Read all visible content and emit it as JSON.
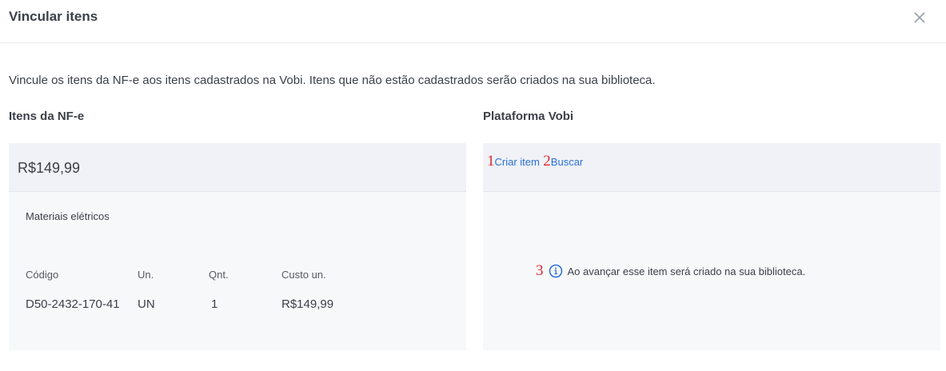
{
  "header": {
    "title": "Vincular itens"
  },
  "description": "Vincule os itens da NF-e aos itens cadastrados na Vobi. Itens que não estão cadastrados serão criados na sua biblioteca.",
  "left": {
    "heading": "Itens da NF-e",
    "price": "R$149,99",
    "category": "Materiais elétricos",
    "columns": [
      "Código",
      "Un.",
      "Qnt.",
      "Custo un."
    ],
    "row": [
      "D50-2432-170-41",
      "UN",
      "1",
      "R$149,99"
    ]
  },
  "right": {
    "heading": "Plataforma Vobi",
    "create_label": "Criar item",
    "search_label": "Buscar",
    "info_text": "Ao avançar esse item será criado na sua biblioteca."
  },
  "markers": [
    "1",
    "2",
    "3"
  ],
  "colors": {
    "link": "#2b6fd6",
    "marker": "#e0262b",
    "panel": "#f7f8fa"
  },
  "icons": {
    "close": "close-icon",
    "info": "info-icon"
  }
}
